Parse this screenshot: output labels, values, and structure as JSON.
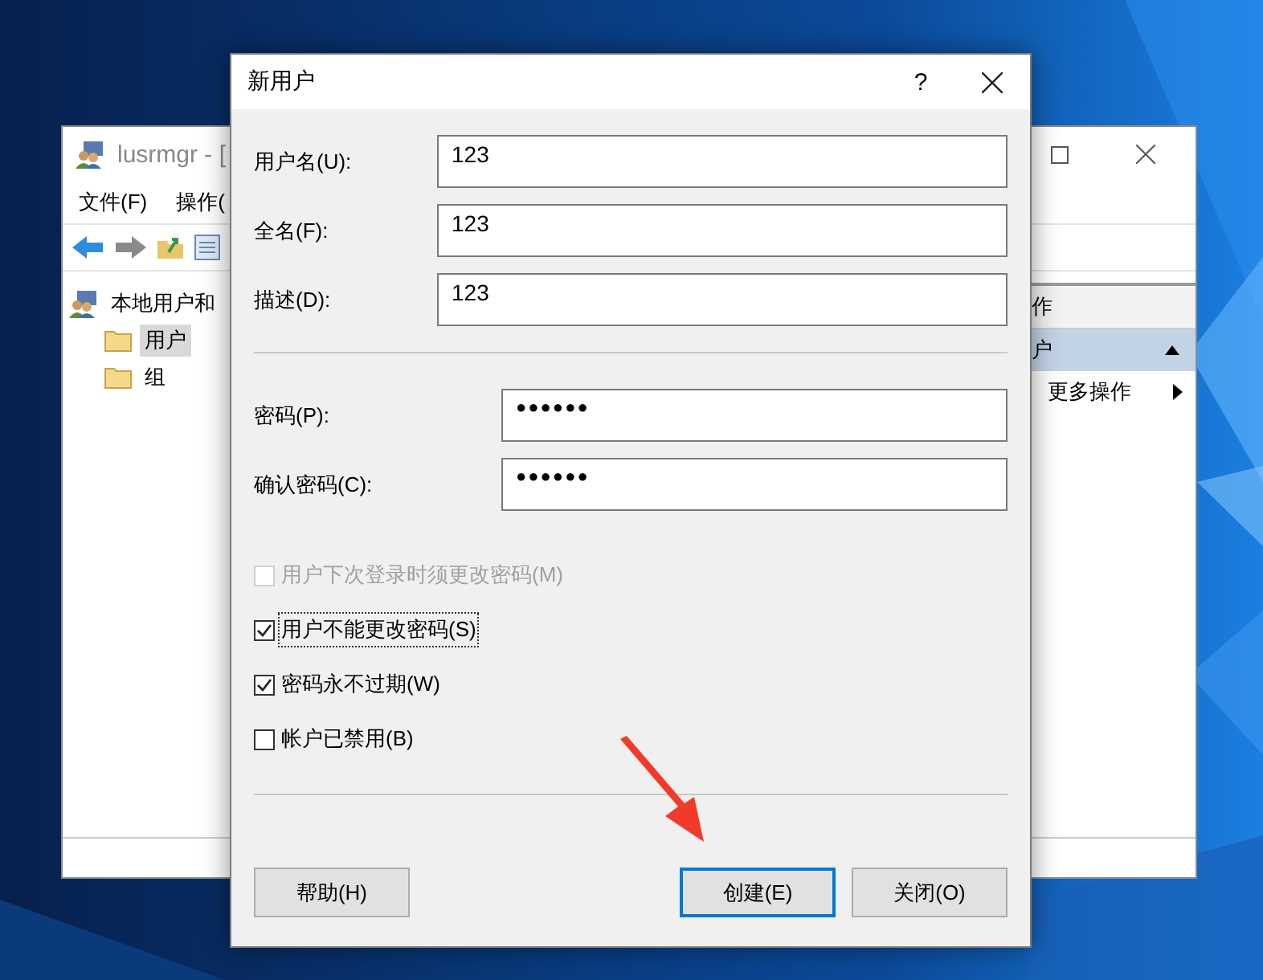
{
  "background_window": {
    "title": "lusrmgr - [",
    "menu": [
      "文件(F)",
      "操作("
    ],
    "tree": [
      {
        "label": "本地用户和",
        "selected": false,
        "children": [
          {
            "label": "用户",
            "selected": true
          },
          {
            "label": "组",
            "selected": false
          }
        ]
      }
    ],
    "actions": {
      "header": "作",
      "section": "户",
      "items": [
        "更多操作"
      ]
    }
  },
  "dialog": {
    "title": "新用户",
    "help": "?",
    "account_fields": [
      {
        "label": "用户名(U):",
        "value": "123"
      },
      {
        "label": "全名(F):",
        "value": "123"
      },
      {
        "label": "描述(D):",
        "value": "123"
      }
    ],
    "password_fields": [
      {
        "label": "密码(P):",
        "value": "●●●●●●"
      },
      {
        "label": "确认密码(C):",
        "value": "●●●●●●"
      }
    ],
    "options": [
      {
        "label": "用户下次登录时须更改密码(M)",
        "checked": false,
        "disabled": true,
        "focused": false
      },
      {
        "label": "用户不能更改密码(S)",
        "checked": true,
        "disabled": false,
        "focused": true
      },
      {
        "label": "密码永不过期(W)",
        "checked": true,
        "disabled": false,
        "focused": false
      },
      {
        "label": "帐户已禁用(B)",
        "checked": false,
        "disabled": false,
        "focused": false
      }
    ],
    "buttons": [
      {
        "label": "帮助(H)",
        "default": false
      },
      {
        "label": "创建(E)",
        "default": true
      },
      {
        "label": "关闭(O)",
        "default": false
      }
    ]
  }
}
